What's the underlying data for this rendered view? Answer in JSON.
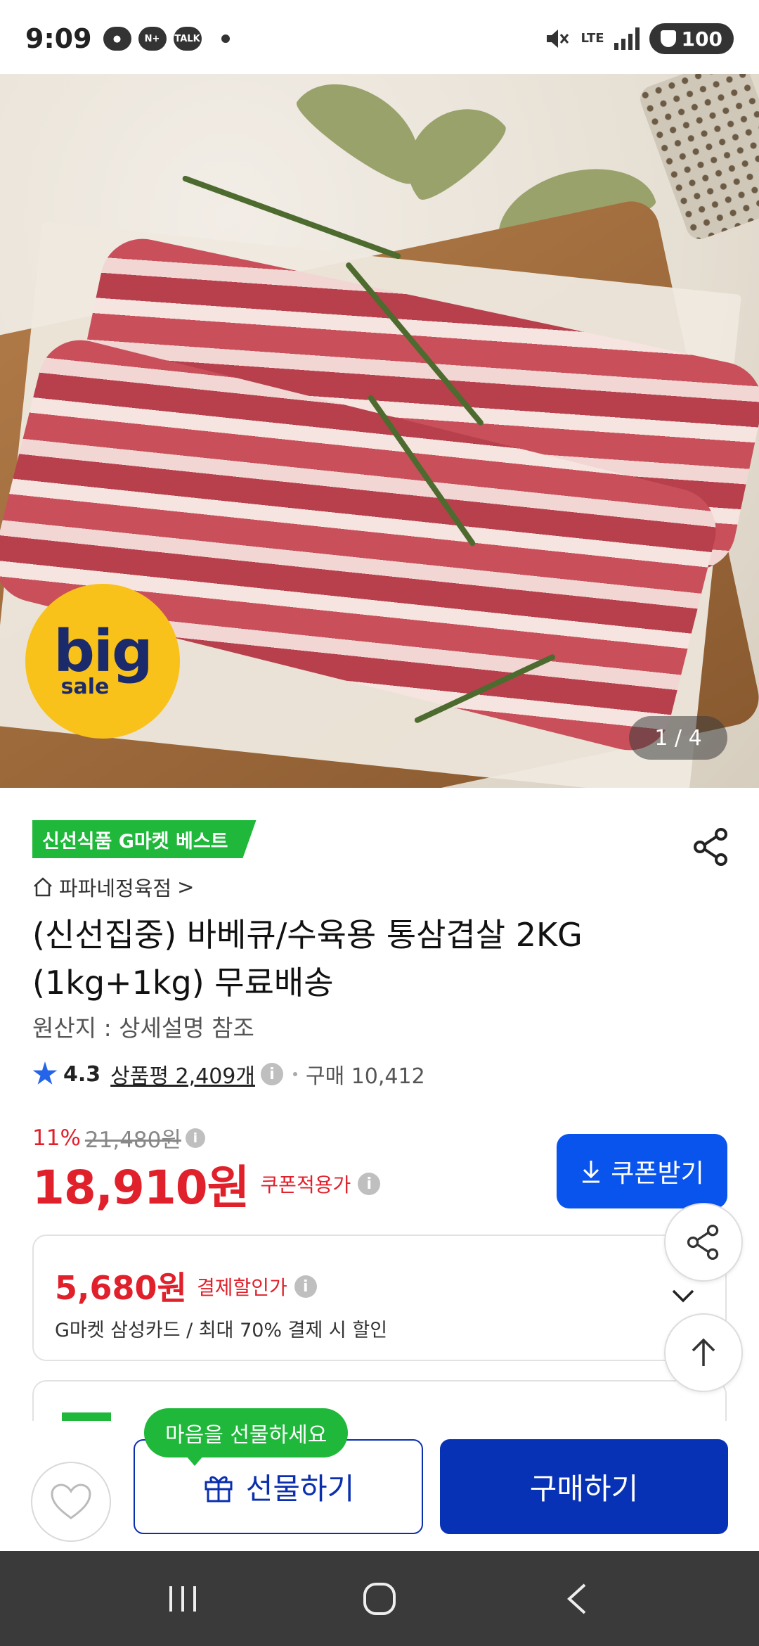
{
  "status_bar": {
    "time": "9:09",
    "icons": [
      "chat-bubble-icon",
      "naver-plus-icon",
      "talk-icon"
    ],
    "talk_label": "TALK",
    "network": "LTE",
    "battery": "100"
  },
  "hero": {
    "badge_big": "big",
    "badge_sale": "sale",
    "image_counter": "1 / 4"
  },
  "product": {
    "best_tag": "신선식품 G마켓 베스트",
    "store_name": "파파네정육점",
    "store_chevron": ">",
    "title": "(신선집중) 바베큐/수육용 통삼겹살 2KG (1kg+1kg) 무료배송",
    "origin": "원산지 : 상세설명 참조",
    "rating": "4.3",
    "reviews_label": "상품평 2,409개",
    "purchase_count": "구매 10,412"
  },
  "pricing": {
    "discount_rate": "11%",
    "original_price": "21,480원",
    "price": "18,910원",
    "coupon_price_label": "쿠폰적용가",
    "coupon_button": "쿠폰받기"
  },
  "payment_discount": {
    "amount": "5,680원",
    "label": "결제할인가",
    "description": "G마켓 삼성카드 / 최대 70% 결제 시 할인"
  },
  "actions": {
    "gift_tooltip": "마음을 선물하세요",
    "gift_button": "선물하기",
    "buy_button": "구매하기"
  },
  "colors": {
    "accent_blue": "#0a54ee",
    "buy_blue": "#0832b5",
    "price_red": "#e0202b",
    "green": "#1fb83a"
  }
}
